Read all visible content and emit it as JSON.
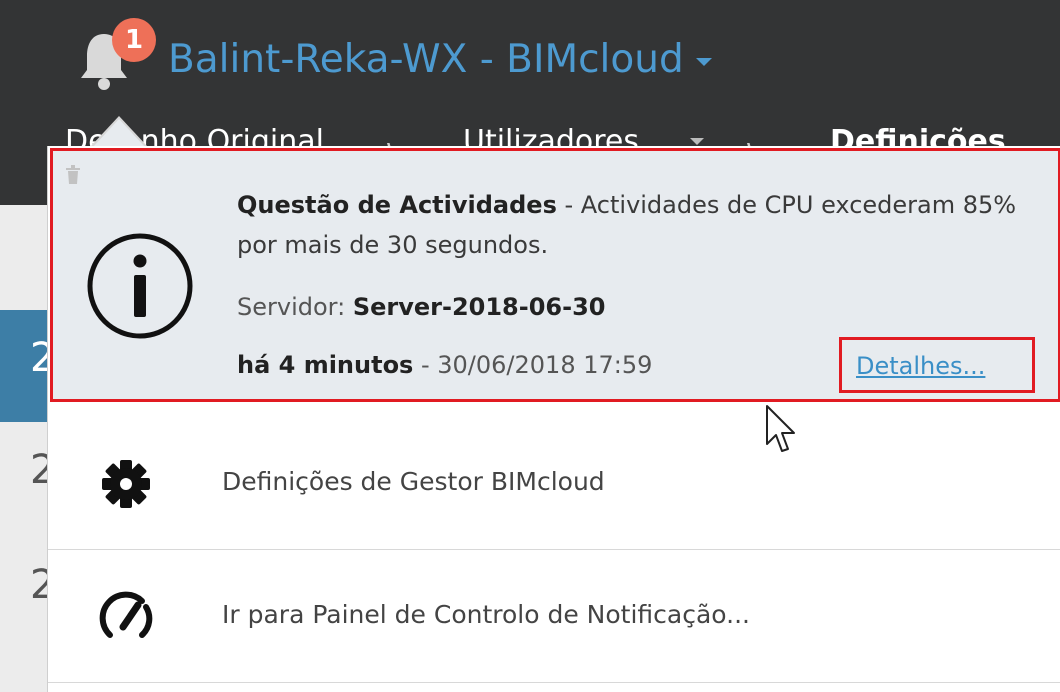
{
  "header": {
    "badge_count": "1",
    "workspace_title": "Balint-Reka-WX - BIMcloud",
    "bell_icon": "bell-icon",
    "caret_icon": "chevron-down-icon"
  },
  "breadcrumb": {
    "items": [
      {
        "label": "Desenho Original"
      },
      {
        "label": "Utilizadores"
      },
      {
        "label": "Definições"
      }
    ]
  },
  "notification": {
    "title": "Questão de Actividades",
    "message": " - Actividades de CPU excederam 85% por mais de 30 segundos.",
    "server_label": "Servidor: ",
    "server_name": "Server-2018-06-30",
    "relative_time": "há 4 minutos",
    "timestamp": " - 30/06/2018 17:59",
    "details_link": "Detalhes...",
    "delete_icon": "trash-icon",
    "type_icon": "info-icon"
  },
  "menu": {
    "items": [
      {
        "label": "Definições de Gestor BIMcloud",
        "icon": "gear-icon"
      },
      {
        "label": "Ir para Painel de Controlo de Notificação...",
        "icon": "gauge-icon"
      }
    ]
  },
  "colors": {
    "header_bg": "#333435",
    "accent_blue": "#4d9ad0",
    "badge": "#ee7058",
    "highlight_red": "#e11b22",
    "notification_bg": "#e7ebef"
  }
}
